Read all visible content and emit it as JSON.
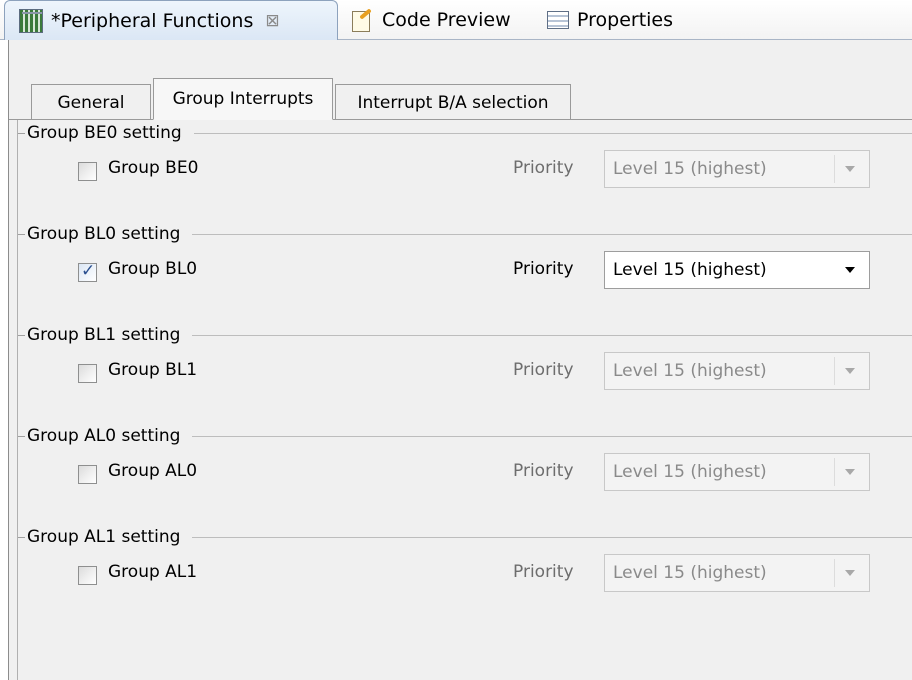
{
  "editor_tabs": [
    {
      "label": "*Peripheral Functions",
      "icon": "peripheral-functions-icon",
      "close": "⊠"
    },
    {
      "label": "Code Preview",
      "icon": "code-preview-icon"
    },
    {
      "label": "Properties",
      "icon": "properties-icon"
    }
  ],
  "sub_tabs": [
    {
      "label": "General"
    },
    {
      "label": "Group Interrupts",
      "selected": true
    },
    {
      "label": "Interrupt B/A selection"
    }
  ],
  "groups": [
    {
      "title": "Group BE0 setting",
      "checkbox_label": "Group BE0",
      "checked": false,
      "priority_label": "Priority",
      "priority_value": "Level 15 (highest)",
      "enabled": false
    },
    {
      "title": "Group BL0 setting",
      "checkbox_label": "Group BL0",
      "checked": true,
      "priority_label": "Priority",
      "priority_value": "Level 15 (highest)",
      "enabled": true
    },
    {
      "title": "Group BL1 setting",
      "checkbox_label": "Group BL1",
      "checked": false,
      "priority_label": "Priority",
      "priority_value": "Level 15 (highest)",
      "enabled": false
    },
    {
      "title": "Group AL0 setting",
      "checkbox_label": "Group AL0",
      "checked": false,
      "priority_label": "Priority",
      "priority_value": "Level 15 (highest)",
      "enabled": false
    },
    {
      "title": "Group AL1 setting",
      "checkbox_label": "Group AL1",
      "checked": false,
      "priority_label": "Priority",
      "priority_value": "Level 15 (highest)",
      "enabled": false
    }
  ]
}
